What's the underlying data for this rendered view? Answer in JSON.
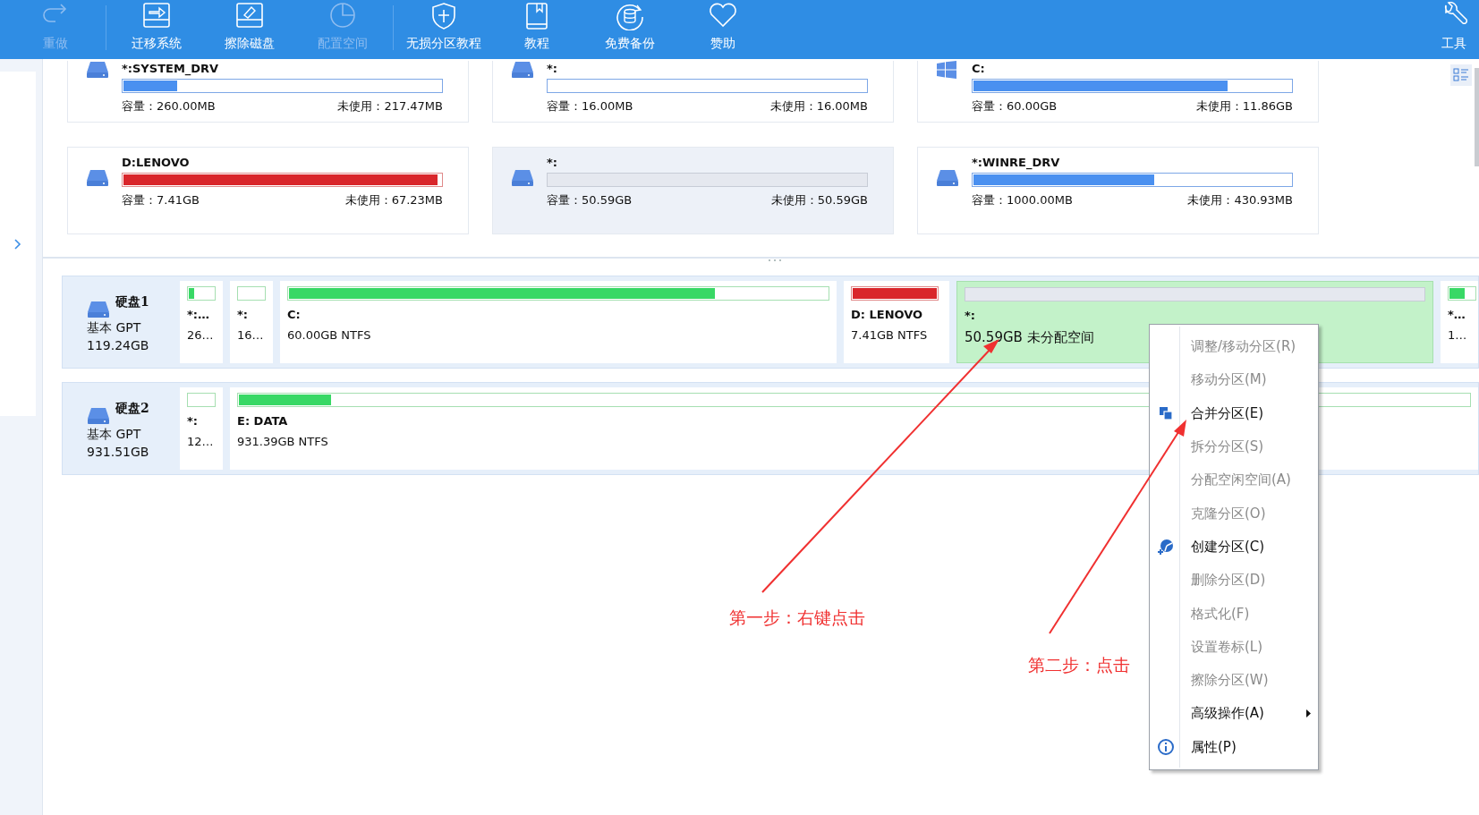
{
  "toolbar": {
    "groups": [
      {
        "items": [
          {
            "label": "重做",
            "kind": "redo",
            "disabled": true
          }
        ]
      },
      {
        "items": [
          {
            "label": "迁移系统",
            "kind": "migrate",
            "disabled": false
          },
          {
            "label": "擦除磁盘",
            "kind": "wipe",
            "disabled": false
          },
          {
            "label": "配置空间",
            "kind": "pie",
            "disabled": true
          }
        ]
      },
      {
        "items": [
          {
            "label": "无损分区教程",
            "kind": "shield",
            "disabled": false
          },
          {
            "label": "教程",
            "kind": "book",
            "disabled": false
          },
          {
            "label": "免费备份",
            "kind": "backup",
            "disabled": false
          },
          {
            "label": "赞助",
            "kind": "heart",
            "disabled": false
          }
        ]
      }
    ],
    "tools": {
      "label": "工具"
    }
  },
  "partition_cards": [
    {
      "name": "*:SYSTEM_DRV",
      "kind": "drive",
      "capacity": "容量：260.00MB",
      "free": "未使用：217.47MB",
      "level": 0.17,
      "color": "#4a90f0",
      "selected": false
    },
    {
      "name": "*:",
      "kind": "drive",
      "capacity": "容量：16.00MB",
      "free": "未使用：16.00MB",
      "selected": false
    },
    {
      "name": "C:",
      "kind": "windows",
      "capacity": "容量：60.00GB",
      "free": "未使用：11.86GB",
      "level": 0.8,
      "color": "#4a90f0",
      "selected": false
    },
    {
      "name": "D:LENOVO",
      "kind": "drive",
      "capacity": "容量：7.41GB",
      "free": "未使用：67.23MB",
      "level": 0.99,
      "color": "#d9262b",
      "selected": false
    },
    {
      "name": "*:",
      "kind": "unallocated",
      "capacity": "容量：50.59GB",
      "free": "未使用：50.59GB",
      "selected": true
    },
    {
      "name": "*:WINRE_DRV",
      "kind": "drive",
      "capacity": "容量：1000.00MB",
      "free": "未使用：430.93MB",
      "level": 0.57,
      "color": "#4a90f0",
      "selected": false
    }
  ],
  "disks": [
    {
      "name": "硬盘1",
      "type": "基本 GPT",
      "size": "119.24GB",
      "partitions": [
        {
          "label": "*:…",
          "info": "26…",
          "level": 0.2,
          "color": "#38d865",
          "selected": false,
          "kind": "small"
        },
        {
          "label": "*:",
          "info": "16…",
          "selected": false,
          "kind": "small"
        },
        {
          "label": "C:",
          "info": "60.00GB NTFS",
          "level": 0.79,
          "color": "#38d865",
          "selected": false,
          "kind": "large"
        },
        {
          "label": "D: LENOVO",
          "info": "7.41GB NTFS",
          "level": 1,
          "color": "#d9262b",
          "selected": false,
          "kind": "medium"
        },
        {
          "label": "*:",
          "info": "50.59GB 未分配空间",
          "selected": true,
          "kind": "unallocated"
        },
        {
          "label": "*…",
          "info": "1…",
          "level": 0.6,
          "color": "#38d865",
          "selected": false,
          "kind": "small"
        }
      ]
    },
    {
      "name": "硬盘2",
      "type": "基本 GPT",
      "size": "931.51GB",
      "partitions": [
        {
          "label": "*:",
          "info": "12…",
          "selected": false,
          "kind": "small"
        },
        {
          "label": "E: DATA",
          "info": "931.39GB NTFS",
          "level": 0.075,
          "color": "#38d865",
          "selected": false,
          "kind": "fill"
        }
      ]
    }
  ],
  "context_menu": {
    "items": [
      {
        "label": "调整/移动分区(R)",
        "disabled": true,
        "kind": "plain"
      },
      {
        "label": "移动分区(M)",
        "disabled": true,
        "kind": "plain"
      },
      {
        "label": "合并分区(E)",
        "disabled": false,
        "kind": "merge"
      },
      {
        "label": "拆分分区(S)",
        "disabled": true,
        "kind": "plain"
      },
      {
        "label": "分配空闲空间(A)",
        "disabled": true,
        "kind": "plain"
      },
      {
        "label": "克隆分区(O)",
        "disabled": true,
        "kind": "plain"
      },
      {
        "label": "创建分区(C)",
        "disabled": false,
        "kind": "create"
      },
      {
        "label": "删除分区(D)",
        "disabled": true,
        "kind": "plain"
      },
      {
        "label": "格式化(F)",
        "disabled": true,
        "kind": "plain"
      },
      {
        "label": "设置卷标(L)",
        "disabled": true,
        "kind": "plain"
      },
      {
        "label": "擦除分区(W)",
        "disabled": true,
        "kind": "plain"
      },
      {
        "label": "高级操作(A)",
        "disabled": false,
        "kind": "submenu"
      },
      {
        "label": "属性(P)",
        "disabled": false,
        "kind": "info"
      }
    ]
  },
  "annotations": [
    {
      "text": "第一步：右键点击"
    },
    {
      "text": "第二步：点击"
    }
  ]
}
